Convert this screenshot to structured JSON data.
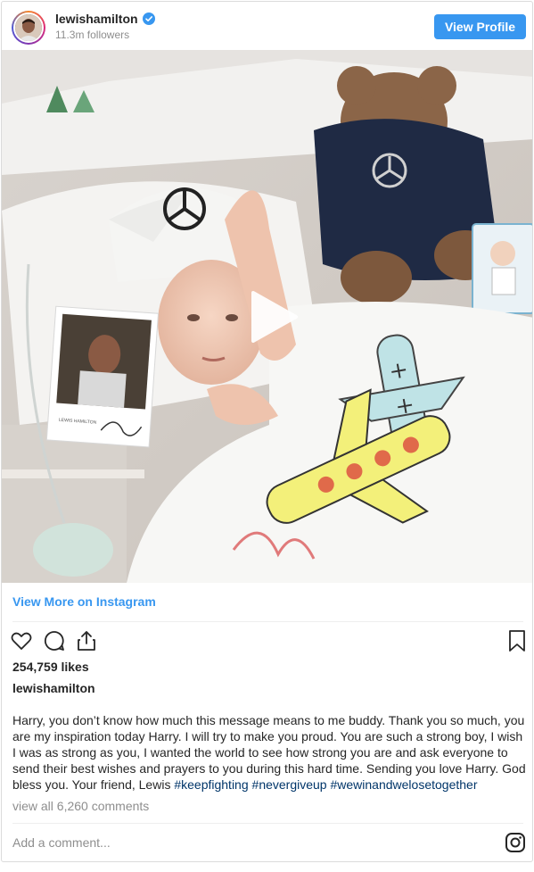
{
  "header": {
    "username": "lewishamilton",
    "followers": "11.3m followers",
    "view_profile_label": "View Profile"
  },
  "media": {
    "photo_card_text": "LEWIS HAMILTON"
  },
  "post": {
    "view_more_label": "View More on Instagram",
    "likes": "254,759 likes",
    "caption_user": "lewishamilton",
    "caption_text": "Harry, you don’t know how much this message means to me buddy. Thank you so much, you are my inspiration today Harry. I will try to make you proud. You are such a strong boy, I wish I was as strong as you, I wanted the world to see how strong you are and ask everyone to send their best wishes and prayers to you during this hard time. Sending you love Harry. God bless you. Your friend, Lewis ",
    "hashtags": [
      "#keepfighting",
      "#nevergiveup",
      "#wewinandwelosetogether"
    ],
    "comments_link": "view all 6,260 comments",
    "comment_placeholder": "Add a comment..."
  },
  "icons": {
    "like": "heart-icon",
    "comment": "comment-bubble-icon",
    "share": "share-icon",
    "save": "bookmark-icon",
    "instagram": "instagram-logo-icon",
    "verified": "verified-badge-icon",
    "play": "play-icon"
  },
  "colors": {
    "accent": "#3897f0",
    "hashtag": "#003569",
    "muted": "#8e8e8e",
    "text": "#262626"
  }
}
